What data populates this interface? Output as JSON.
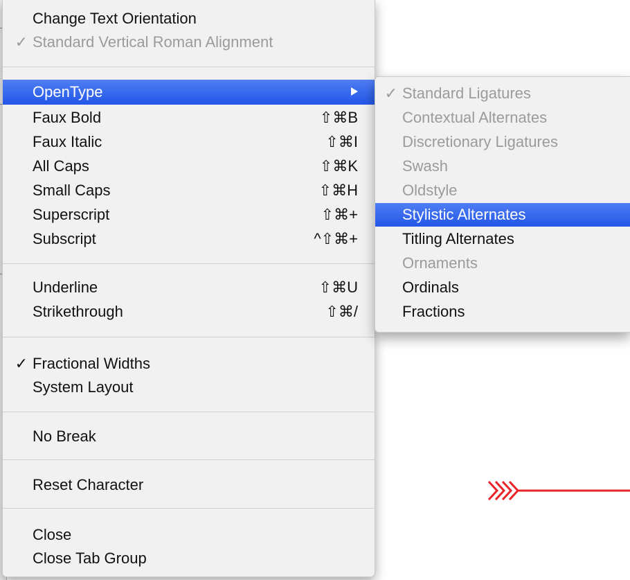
{
  "main_menu": {
    "groups": [
      {
        "items": [
          {
            "label": "Change Text Orientation",
            "checked": false,
            "disabled": false
          },
          {
            "label": "Standard Vertical Roman Alignment",
            "checked": true,
            "disabled": true
          }
        ]
      },
      {
        "items": [
          {
            "label": "OpenType",
            "highlighted": true,
            "has_submenu": true
          },
          {
            "label": "Faux Bold",
            "shortcut": "⇧⌘B"
          },
          {
            "label": "Faux Italic",
            "shortcut": "⇧⌘I"
          },
          {
            "label": "All Caps",
            "shortcut": "⇧⌘K"
          },
          {
            "label": "Small Caps",
            "shortcut": "⇧⌘H"
          },
          {
            "label": "Superscript",
            "shortcut": "⇧⌘+"
          },
          {
            "label": "Subscript",
            "shortcut": "^⇧⌘+"
          }
        ]
      },
      {
        "items": [
          {
            "label": "Underline",
            "shortcut": "⇧⌘U"
          },
          {
            "label": "Strikethrough",
            "shortcut": "⇧⌘/"
          }
        ]
      },
      {
        "items": [
          {
            "label": "Fractional Widths",
            "checked": true
          },
          {
            "label": "System Layout"
          }
        ]
      },
      {
        "items": [
          {
            "label": "No Break"
          }
        ]
      },
      {
        "items": [
          {
            "label": "Reset Character"
          }
        ]
      },
      {
        "items": [
          {
            "label": "Close"
          },
          {
            "label": "Close Tab Group"
          }
        ]
      }
    ]
  },
  "opentype_submenu": {
    "items": [
      {
        "label": "Standard Ligatures",
        "checked": true,
        "disabled": true
      },
      {
        "label": "Contextual Alternates",
        "disabled": true
      },
      {
        "label": "Discretionary Ligatures",
        "disabled": true
      },
      {
        "label": "Swash",
        "disabled": true
      },
      {
        "label": "Oldstyle",
        "disabled": true
      },
      {
        "label": "Stylistic Alternates",
        "highlighted": true
      },
      {
        "label": "Titling Alternates"
      },
      {
        "label": "Ornaments",
        "disabled": true
      },
      {
        "label": "Ordinals"
      },
      {
        "label": "Fractions"
      }
    ]
  },
  "check_glyph": "✓",
  "colors": {
    "highlight": "#2f63ec",
    "annotation_arrow": "#e8232a"
  }
}
